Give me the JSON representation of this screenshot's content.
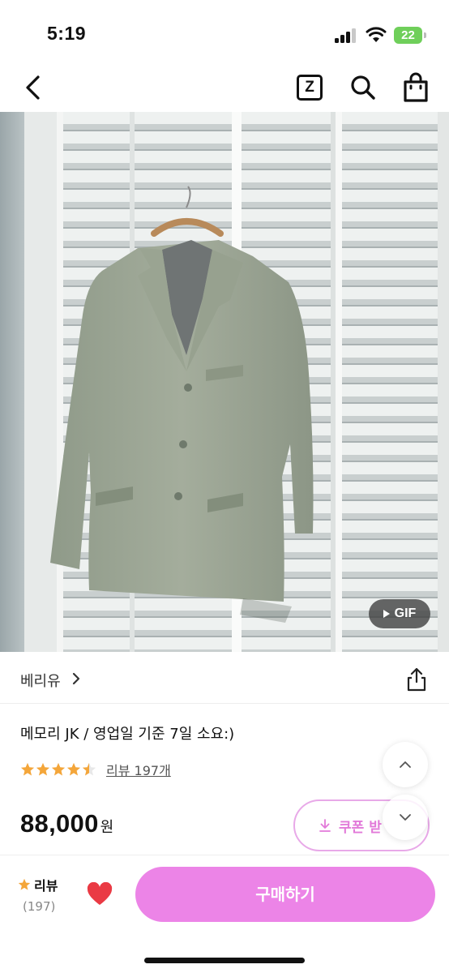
{
  "status_bar": {
    "time": "5:19",
    "battery": "22"
  },
  "nav": {
    "z_label": "Z",
    "icons": [
      "back-icon",
      "z-icon",
      "search-icon",
      "shopping-bag-icon"
    ]
  },
  "media": {
    "gif_label": "GIF"
  },
  "store": {
    "name": "베리유"
  },
  "product": {
    "title": "메모리 JK / 영업일 기준 7일 소요:)",
    "rating": 4.5,
    "review_link": "리뷰 197개",
    "price": "88,000",
    "price_unit": "원",
    "coupon_label": "쿠폰 받"
  },
  "bottom_bar": {
    "review_label": "리뷰",
    "review_count": "(197)",
    "buy_label": "구매하기"
  },
  "colors": {
    "accent": "#ec84e7",
    "coupon": "#e27ad9",
    "star": "#f4a63a",
    "heart": "#ea3a44",
    "battery": "#6fcf5a"
  }
}
